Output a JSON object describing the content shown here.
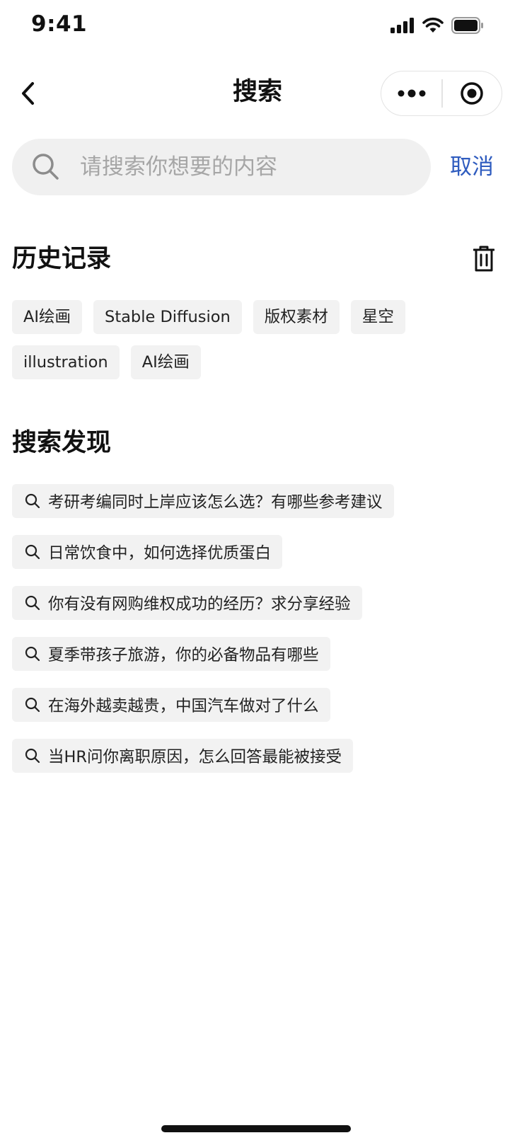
{
  "status_bar": {
    "time": "9:41"
  },
  "nav": {
    "title": "搜索"
  },
  "search": {
    "placeholder": "请搜索你想要的内容",
    "cancel_label": "取消"
  },
  "history": {
    "title": "历史记录",
    "tags": [
      "AI绘画",
      "Stable Diffusion",
      "版权素材",
      "星空",
      "illustration",
      "AI绘画"
    ]
  },
  "discover": {
    "title": "搜索发现",
    "items": [
      "考研考编同时上岸应该怎么选？有哪些参考建议",
      "日常饮食中，如何选择优质蛋白",
      "你有没有网购维权成功的经历？求分享经验",
      "夏季带孩子旅游，你的必备物品有哪些",
      "在海外越卖越贵，中国汽车做对了什么",
      "当HR问你离职原因，怎么回答最能被接受"
    ]
  },
  "icons": {
    "status": [
      "signal-icon",
      "wifi-icon",
      "battery-icon"
    ],
    "nav": [
      "back-icon",
      "more-icon",
      "close-target-icon"
    ],
    "search": "search-icon",
    "history_action": "trash-icon"
  },
  "colors": {
    "accent": "#2f5cbf",
    "tag_bg": "#f2f2f2",
    "search_bg": "#f0f0f0"
  }
}
